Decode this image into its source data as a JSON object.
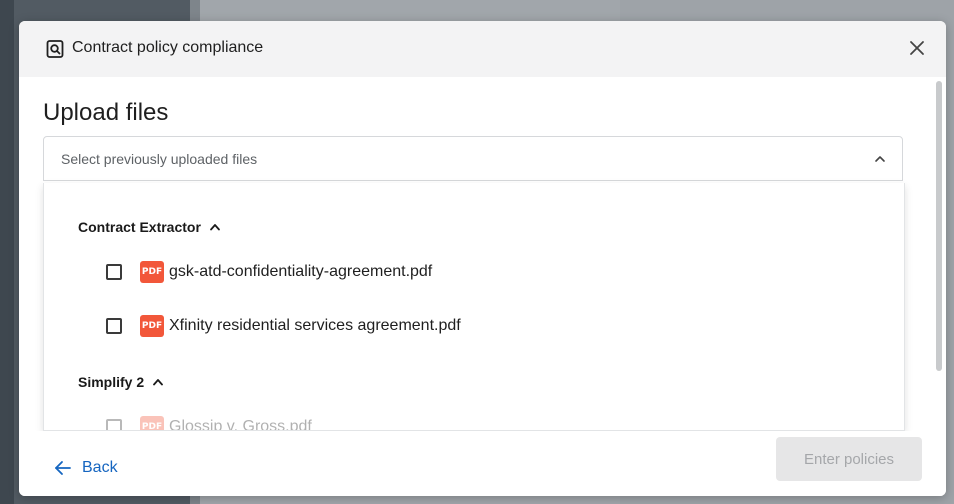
{
  "modal": {
    "title": "Contract policy compliance",
    "section_title": "Upload files"
  },
  "select": {
    "placeholder": "Select previously uploaded files",
    "expanded": true
  },
  "groups": [
    {
      "name": "Contract Extractor",
      "expanded": true,
      "files": [
        {
          "badge": "PDF",
          "name": "gsk-atd-confidentiality-agreement.pdf",
          "checked": false
        },
        {
          "badge": "PDF",
          "name": "Xfinity residential services agreement.pdf",
          "checked": false
        }
      ]
    },
    {
      "name": "Simplify 2",
      "expanded": true,
      "files": [
        {
          "badge": "PDF",
          "name": "Glossip v. Gross.pdf",
          "checked": false
        }
      ]
    }
  ],
  "footer": {
    "back_label": "Back",
    "enter_label": "Enter policies"
  },
  "colors": {
    "accent": "#1565c0",
    "pdf_badge": "#f2573a",
    "disabled_button_bg": "#e6e6e7"
  },
  "icons": {
    "header": "document-search-icon",
    "close": "close-icon",
    "chevron": "chevron-up-icon",
    "back": "arrow-left-icon"
  }
}
